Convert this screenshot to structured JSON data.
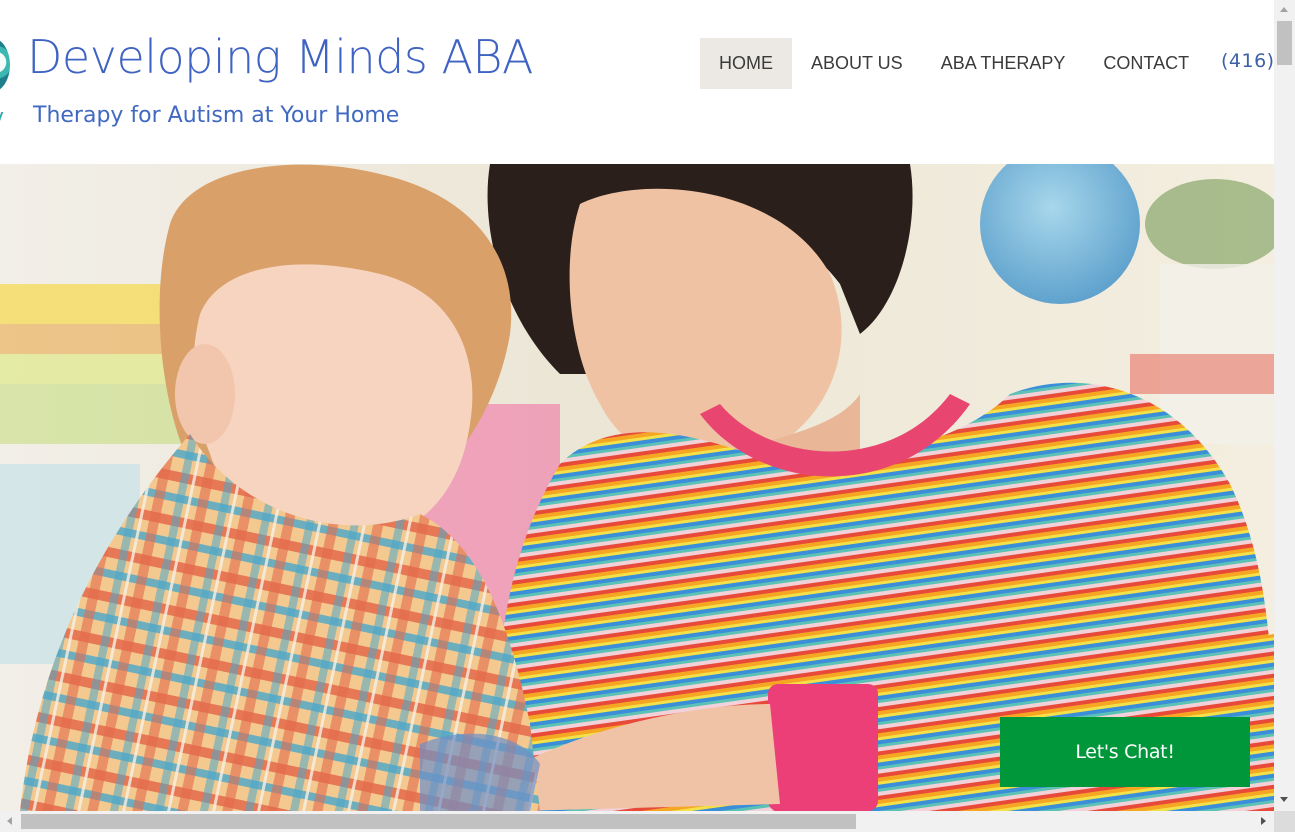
{
  "header": {
    "site_title": "Developing Minds ABA",
    "tagline": "Therapy for Autism at Your Home",
    "logo_icon": "logo-icon",
    "title_color": "#3f63c2"
  },
  "nav": {
    "items": [
      {
        "label": "HOME",
        "active": true
      },
      {
        "label": "ABOUT US",
        "active": false
      },
      {
        "label": "ABA THERAPY",
        "active": false
      },
      {
        "label": "CONTACT",
        "active": false
      }
    ],
    "phone": "(416)"
  },
  "hero": {
    "image_subject": "hero-photo",
    "chat_button_label": "Let's Chat!",
    "chat_button_color": "#00963a"
  },
  "scrollbars": {
    "vertical_icon_up": "arrow-up-icon",
    "vertical_icon_down": "arrow-down-icon",
    "horizontal_icon_left": "arrow-left-icon",
    "horizontal_icon_right": "arrow-right-icon"
  }
}
